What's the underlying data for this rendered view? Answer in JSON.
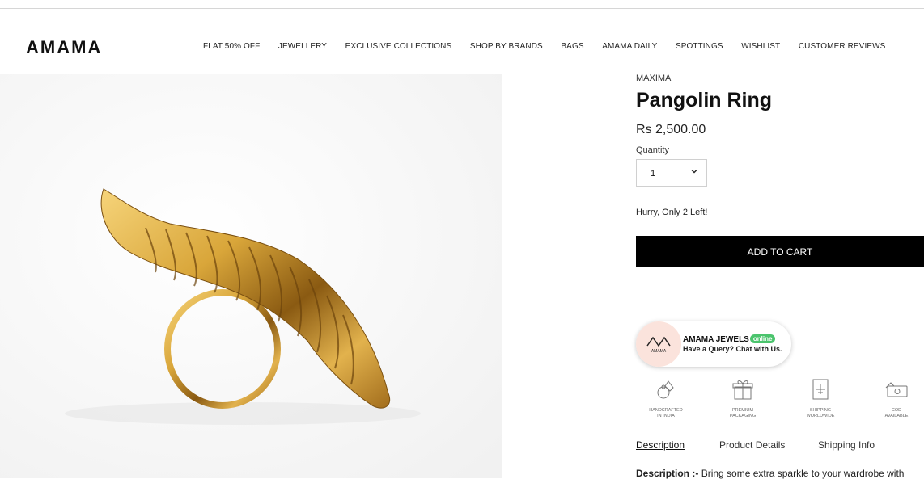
{
  "header": {
    "logo": "AMAMA",
    "nav": [
      "FLAT 50% OFF",
      "JEWELLERY",
      "EXCLUSIVE COLLECTIONS",
      "SHOP BY BRANDS",
      "BAGS",
      "AMAMA DAILY",
      "SPOTTINGS",
      "WISHLIST",
      "CUSTOMER REVIEWS"
    ]
  },
  "product": {
    "brand": "MAXIMA",
    "title": "Pangolin Ring",
    "price": "Rs 2,500.00",
    "quantity_label": "Quantity",
    "quantity_value": "1",
    "stock_text": "Hurry, Only 2 Left!",
    "add_to_cart": "ADD TO CART"
  },
  "chat": {
    "name": "AMAMA JEWELS",
    "status": "online",
    "subtitle": "Have a Query? Chat with Us.",
    "avatar_text": "AMAMA"
  },
  "badges": [
    {
      "line1": "HANDCRAFTED",
      "line2": "IN INDIA",
      "icon": "handcraft-icon"
    },
    {
      "line1": "PREMIUM",
      "line2": "PACKAGING",
      "icon": "gift-box-icon"
    },
    {
      "line1": "SHIPPING",
      "line2": "WORLDWIDE",
      "icon": "shipping-icon"
    },
    {
      "line1": "COD",
      "line2": "AVAILABLE",
      "icon": "cash-icon"
    }
  ],
  "tabs": [
    "Description",
    "Product Details",
    "Shipping Info"
  ],
  "description": {
    "label": "Description :-",
    "text": "Bring some extra sparkle to your wardrobe with"
  },
  "colors": {
    "accent": "#000000",
    "online": "#4bc46d",
    "chat_avatar_bg": "#fbe3dc",
    "gold": "#d9a63a"
  }
}
